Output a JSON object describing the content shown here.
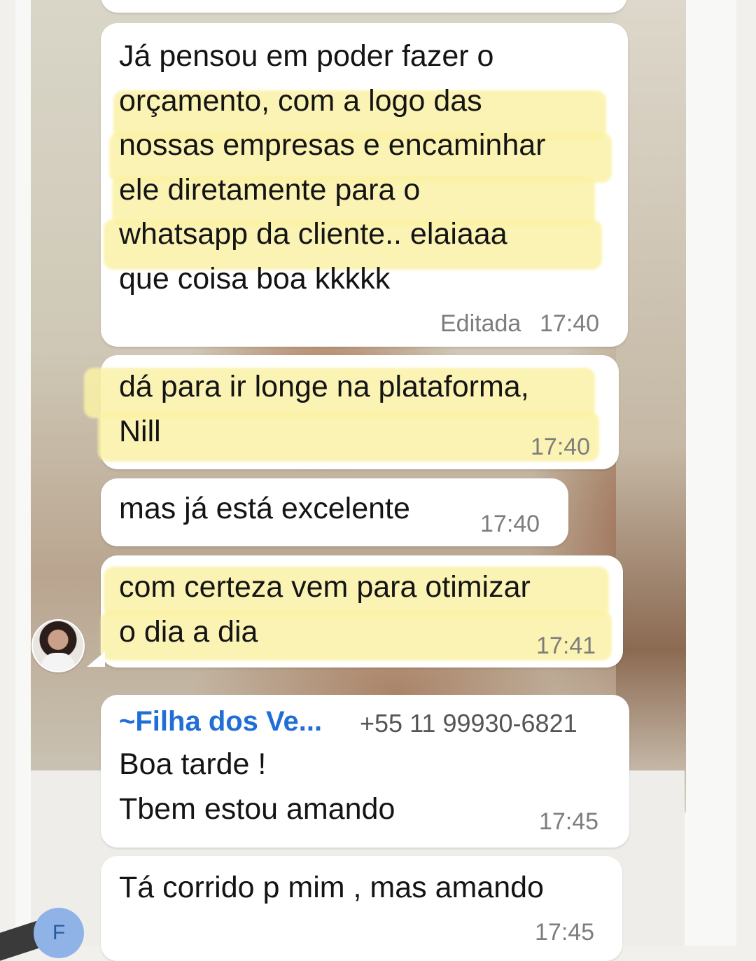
{
  "messages": [
    {
      "text": "Já pensou em poder fazer o\norçamento, com a logo das\nnossas empresas e encaminhar\nele diretamente para o\nwhatsapp da cliente.. elaiaaa\nque coisa boa kkkkk",
      "status": "Editada",
      "time": "17:40",
      "highlighted": true
    },
    {
      "text": "dá para ir longe na plataforma,\nNill",
      "time": "17:40",
      "highlighted": true
    },
    {
      "text": "mas já está excelente",
      "time": "17:40",
      "highlighted": false
    },
    {
      "text": "com certeza vem para otimizar\no dia a dia",
      "time": "17:41",
      "highlighted": true
    },
    {
      "sender": "~Filha dos Ve...",
      "phone": "+55 11 99930-6821",
      "text": "Boa tarde !\nTbem estou amando",
      "time": "17:45",
      "sender_color": "#1f6fd6"
    },
    {
      "text": "Tá corrido p mim , mas amando",
      "time": "17:45"
    }
  ],
  "avatars": [
    {
      "icon": "profile-photo-avatar"
    },
    {
      "letter": "F",
      "color": "#8fb3e6"
    }
  ],
  "colors": {
    "bubble": "#ffffff",
    "highlight": "#fbf2a6",
    "time": "#7d7d7d"
  }
}
